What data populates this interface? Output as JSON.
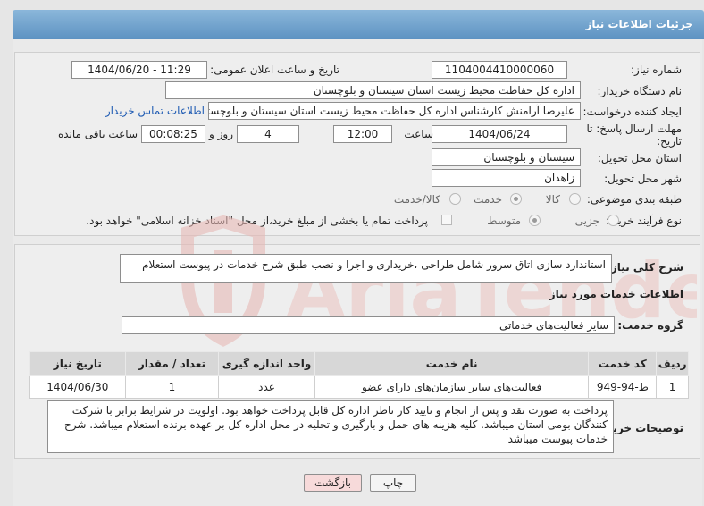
{
  "window": {
    "title": "جزئیات اطلاعات نیاز"
  },
  "form": {
    "need_number": {
      "label": "شماره نیاز:",
      "value": "1104004410000060"
    },
    "announce_datetime": {
      "label": "تاریخ و ساعت اعلان عمومی:",
      "value": "1404/06/20 - 11:29"
    },
    "buyer_org": {
      "label": "نام دستگاه خریدار:",
      "value": "اداره کل حفاظت محیط زیست استان سیستان و بلوچستان"
    },
    "requester": {
      "label": "ایجاد کننده درخواست:",
      "value": "علیرضا آرامنش کارشناس اداره کل حفاظت محیط زیست استان سیستان و بلوچستان"
    },
    "buyer_contact_link": "اطلاعات تماس خریدار",
    "deadline": {
      "label_line1": "مهلت ارسال پاسخ: تا",
      "label_line2": "تاریخ:",
      "date": "1404/06/24",
      "time_label": "ساعت",
      "time": "12:00",
      "days": "4",
      "days_label": "روز و",
      "remaining": "00:08:25",
      "remaining_label": "ساعت باقی مانده"
    },
    "delivery_province": {
      "label": "استان محل تحویل:",
      "value": "سیستان و بلوچستان"
    },
    "delivery_city": {
      "label": "شهر محل تحویل:",
      "value": "زاهدان"
    },
    "category": {
      "label": "طبقه بندی موضوعی:",
      "options": [
        "کالا",
        "خدمت",
        "کالا/خدمت"
      ],
      "selected": "خدمت"
    },
    "purchase_process": {
      "label": "نوع فرآیند خرید :",
      "options": [
        "جزیی",
        "متوسط"
      ],
      "selected": "متوسط",
      "checkbox_label": "پرداخت تمام یا بخشی از مبلغ خرید،از محل \"اسناد خزانه اسلامی\" خواهد بود."
    }
  },
  "general_description": {
    "label": "شرح کلی نیاز:",
    "value": "استاندارد سازی اتاق سرور شامل طراحی ،خریداری و اجرا و نصب طبق شرح خدمات در پیوست استعلام"
  },
  "services": {
    "section_title": "اطلاعات خدمات مورد نیاز",
    "group_label": "گروه خدمت:",
    "group_value": "سایر فعالیت‌های خدماتی",
    "columns": [
      "ردیف",
      "کد خدمت",
      "نام خدمت",
      "واحد اندازه گیری",
      "تعداد / مقدار",
      "تاریخ نیاز"
    ],
    "rows": [
      {
        "row": "1",
        "code": "ط-94-949",
        "name": "فعالیت‌های سایر سازمان‌های دارای عضو",
        "unit": "عدد",
        "qty": "1",
        "date": "1404/06/30"
      }
    ]
  },
  "buyer_notes": {
    "label": "توضیحات خریدار:",
    "value": "پرداخت به صورت نقد و پس از انجام و تایید کار ناظر اداره کل قابل پرداخت خواهد بود. اولویت در شرایط برابر با شرکت کنندگان بومی استان میباشد. کلیه هزینه های حمل و بارگیری و تخلیه در محل اداره کل بر عهده برنده استعلام میباشد. شرح خدمات پیوست میباشد"
  },
  "buttons": {
    "print": "چاپ",
    "back": "بازگشت"
  },
  "colors": {
    "title_bar": "#6f9fcc",
    "link": "#1f5bb3",
    "back_button": "#f7dada",
    "watermark": "#e7b9b6"
  }
}
